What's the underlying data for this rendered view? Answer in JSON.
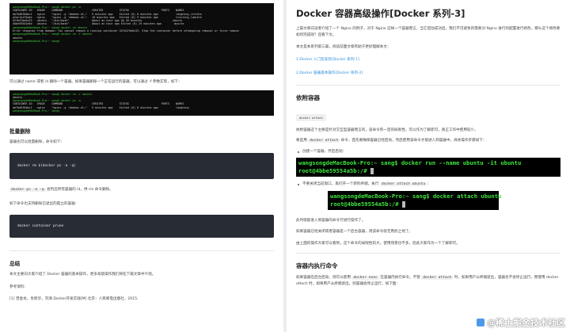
{
  "left": {
    "terminal1_lines": [
      "wangsongdeMacBook-Pro:~ sang$ docker ps -a",
      "CONTAINER ID   IMAGE    COMMAND                  CREATED          STATUS                    PORTS    NAMES",
      "ab7bd8f6dbc1   nginx    \"nginx -g 'daemon of…\"   9 minutes ago    Exited (0) 8 minutes ago           laughing_ritchie",
      "a2ac1a1f5a4e   nginx    \"nginx -g 'daemon of…\"   10 minutes ago   Exited (0) 9 minutes ago           trusting_lumiere",
      "52fb47de0c53   ubuntu   \"/bin/bash\"              About an hour ago Up 26 minutes                   ubuntu",
      "4bbe59554a5b   ubuntu   \"/bin/bash\"              About an hour ago Exited (0) 29 minutes ago        mysite",
      "wangsongdeMacBook-Pro:~ sang$ docker rm ubuntu",
      "Error response from daemon: You cannot remove a running container 52fb47de0c53. Stop the container before attempting removal or force remove",
      "wangsongdeMacBook-Pro:~ sang$ docker rm -f ubuntu",
      "ubuntu",
      "wangsongdeMacBook-Pro:~ sang$"
    ],
    "para1": "可以通过 name 或者 id 删除一个容器。如果容器删除一个正在运行的容器，可以通过 -f 参数实现，如下：",
    "terminal2_lines": [
      "wangsongdeMacBook-Pro:~ sang$ docker rm -f ubuntu",
      "ubuntu",
      "wangsongdeMacBook-Pro:~ sang$ docker ps -a",
      "CONTAINER ID   IMAGE    COMMAND                  CREATED          STATUS                    PORTS    NAMES",
      "ab7bd8f6dbc1   nginx    \"nginx -g 'daemon of…\"   9 minutes ago    Exited (0) 8 minutes ago           laughing",
      "wangsongdeMacBook-Pro:~ sang$"
    ],
    "heading_batch": "批量删除",
    "para2": "容器也可以批量删除，命令如下：",
    "code1": "docker rm $(docker ps -a -q)",
    "para3_pre": "",
    "para3_code": "docker ps -a -q",
    "para3_post": " 会列出所有容器的 id，供 rm 命令删除。",
    "para4": "如下命令也支持删除已退出的孤立的容器：",
    "code2": "docker container prune",
    "heading_summary": "总结",
    "para5": "本文主要向大家介绍了 Docker 容器的基本操作，更多高级操作我们将在下篇文章中介绍。",
    "para6": "参考资料：",
    "para7": "[1] 曾金龙，肖新华，刘清.Docker开发实践[M].北京：人民邮电出版社，2015."
  },
  "right": {
    "title": "Docker 容器高级操作[Docker 系列-3]",
    "para1": "上篇文章向读者介绍了一个 Nginx 的例子，对于 Nginx 这样一个容器而言，当它启动成功后，我们不可避免的需要对 Nginx 进行的配置进行修改，那么这个修改要如何完成呢？且看下文。",
    "para2": "本文是本系列第三篇，阅读前面文章有助于更好理解本文：",
    "link1": "1.Docker 入门及安装[Docker 系列-1]",
    "link2": "2.Docker 容器基本操作[Docker 系列-2]",
    "heading_attach": "依附容器",
    "badge_attach": "docker attach",
    "para3": "依附容器这个主要是针对交互型容器而言的，该命令有一定的局限性，可以作为了解即可，真正工作中使用较少。",
    "para4_pre": "要是用 ",
    "para4_code": "docker attach",
    "para4_post": " 命令，首先要确保容器已经启动，然后使用该命令才能进入到容器中。具体操作步骤如下：",
    "bullet1": "创建一个容器，然后启动：",
    "bigterm1_lines": [
      "wangsongdeMacBook-Pro:~ sang$ docker run --name ubuntu -it ubuntu",
      "root@4bbe59554a5b:/# "
    ],
    "bullet2_pre": "不要关闭当前窗口，再打开一个新的终端，执行 ",
    "bullet2_code": "docker attach ubuntu",
    "bullet2_post": "：",
    "bigterm2_lines": [
      "wangsongdeMacBook-Pro:~ sang$ docker attach ubuntu",
      "root@4bbe59554a5b:/# "
    ],
    "para5": "此时就能进入到容器的命令行进行操作了。",
    "para6": "如果容器已经关闭或者容器是一个后台容器，则该命令就无用武之地了。",
    "para7": "由上面的操作大家可以看到，这个命令的局限性较大，使用场景也不多，因此大家作为一个了解即可。",
    "heading_exec": "容器内执行命令",
    "para8_pre": "如果容器在后台启动，则可以使用 ",
    "para8_code": "docker exec",
    "para8_mid": " 在容器内执行命令。不管 ",
    "para8_code2": "docker attach",
    "para8_post": " 时，如果用户从终端退出，容器也不会停止运行，而使用 docker attach 时，如果用户从终端退出，则容器会停止运行，如下图："
  },
  "watermark": "@稀土掘金技术社区"
}
